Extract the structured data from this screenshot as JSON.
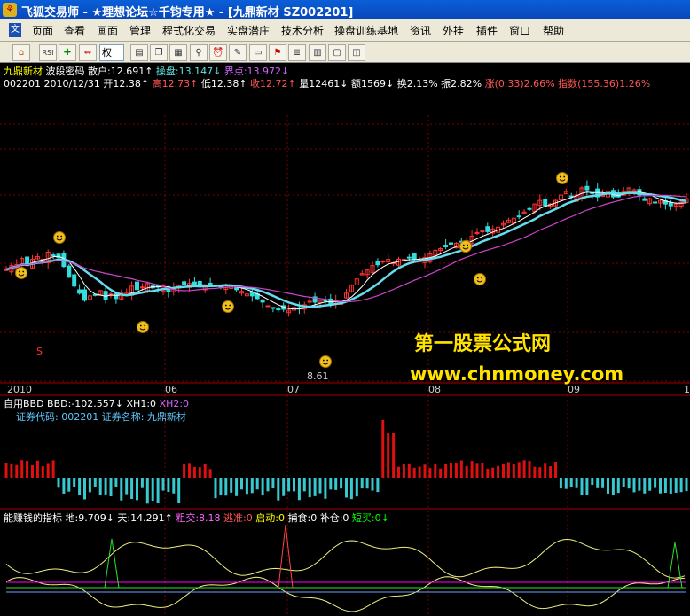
{
  "window": {
    "title": "飞狐交易师  - ★理想论坛☆千钧专用★ - [九鼎新材  SZ002201]",
    "logo_glyph": "⚘"
  },
  "menu": {
    "logo": "文",
    "items": [
      "页面",
      "查看",
      "画面",
      "管理",
      "程式化交易",
      "实盘潜庄",
      "技术分析",
      "操盘训练基地",
      "资讯",
      "外挂",
      "插件",
      "窗口",
      "帮助"
    ]
  },
  "toolbar": {
    "select_value": "权",
    "buttons": [
      "home-icon",
      "rsi-icon",
      "plus-cross-icon",
      "arrow-lr-icon",
      "select",
      "layout-icon",
      "copy-icon",
      "grid-icon",
      "zoom-icon",
      "alarm-icon",
      "pen-icon",
      "book-icon",
      "draw-icon",
      "list-icon",
      "panel-icon",
      "window-icon",
      "chart-icon"
    ]
  },
  "header": {
    "line1": [
      {
        "text": "九鼎新材",
        "color": "#ffff00"
      },
      {
        "text": " 波段密码",
        "color": "#ffffff"
      },
      {
        "text": " 散户:12.691↑",
        "color": "#ffffff"
      },
      {
        "text": " 操盘:13.147↓",
        "color": "#5fe0e0"
      },
      {
        "text": " 界点:13.972↓",
        "color": "#d066ff"
      }
    ],
    "line2": [
      {
        "text": "002201 2010/12/31",
        "color": "#ffffff"
      },
      {
        "text": " 开12.38↑",
        "color": "#ffffff"
      },
      {
        "text": " 高12.73↑",
        "color": "#ff5555"
      },
      {
        "text": " 低12.38↑",
        "color": "#ffffff"
      },
      {
        "text": " 收12.72↑",
        "color": "#ff5555"
      },
      {
        "text": " 量12461↓",
        "color": "#ffffff"
      },
      {
        "text": " 额1569↓",
        "color": "#ffffff"
      },
      {
        "text": " 换2.13%",
        "color": "#ffffff"
      },
      {
        "text": " 振2.82%",
        "color": "#ffffff"
      },
      {
        "text": " 涨(0.33)2.66%",
        "color": "#ff5555"
      },
      {
        "text": " 指数(155.36)1.26%",
        "color": "#ff5555"
      }
    ]
  },
  "price_panel": {
    "low_label": "8.61",
    "s_marker": "S",
    "date_labels": [
      "2010",
      "06",
      "07",
      "08",
      "09",
      "1"
    ]
  },
  "watermark": {
    "line1": "第一股票公式网",
    "line2": "www.chnmoney.com"
  },
  "bbd_panel": {
    "line1": [
      {
        "text": "自用BBD BBD:-102.557↓",
        "color": "#ffffff"
      },
      {
        "text": " XH1:0",
        "color": "#ffffff"
      },
      {
        "text": " XH2:0",
        "color": "#d066ff"
      }
    ],
    "line2": "证券代码: 002201 证券名称: 九鼎新材"
  },
  "indicator_panel": {
    "line": [
      {
        "text": "能赚钱的指标 地:9.709↓",
        "color": "#ffffff"
      },
      {
        "text": "天:14.291↑",
        "color": "#ffffff"
      },
      {
        "text": "粗交:8.18",
        "color": "#ff66ff"
      },
      {
        "text": "逃准:0",
        "color": "#ff5555"
      },
      {
        "text": "启动:0",
        "color": "#ffff00"
      },
      {
        "text": "捕食:0",
        "color": "#ffffff"
      },
      {
        "text": "补仓:0",
        "color": "#ffffff"
      },
      {
        "text": "短买:0↓",
        "color": "#00ff00"
      }
    ]
  },
  "colors": {
    "up": "#ff3333",
    "down": "#33dddd",
    "line_white": "#ffffff",
    "line_cyan": "#66ddee",
    "line_magenta": "#cc44cc",
    "bbd_up": "#e01010",
    "bbd_down": "#38c8d0",
    "ind_yellow": "#f0f080",
    "ind_green": "#30e030",
    "ind_magenta": "#ff00ff",
    "ind_blue": "#6aa0ff",
    "grid": "#7a0000",
    "smile": "#f0c020"
  },
  "price_series": [
    12.72,
    12.95,
    13.0,
    13.35,
    12.95,
    13.3,
    13.45,
    13.3,
    13.7,
    13.5,
    13.4,
    12.9,
    12.3,
    11.8,
    11.4,
    11.0,
    11.25,
    11.3,
    11.55,
    11.05,
    11.35,
    11.1,
    11.45,
    11.4,
    11.8,
    11.6,
    11.75,
    11.95,
    11.7,
    11.75,
    11.8,
    11.5,
    11.7,
    11.85,
    11.9,
    11.95,
    11.9,
    11.8,
    11.8,
    11.85,
    11.85,
    11.75,
    11.85,
    11.75,
    11.6,
    11.5,
    11.35,
    11.25,
    11.1,
    10.9,
    10.7,
    10.55,
    10.5,
    10.5,
    10.45,
    10.6,
    10.55,
    10.75,
    10.95,
    10.9,
    11.0,
    10.95,
    10.8,
    11.0,
    10.9,
    11.4,
    11.85,
    12.2,
    12.5,
    12.7,
    12.95,
    13.0,
    13.2,
    13.3,
    13.1,
    13.3,
    13.3,
    13.4,
    13.3,
    13.3,
    13.4,
    13.6,
    13.8,
    13.9,
    14.0,
    14.15,
    14.2,
    14.3,
    14.35,
    14.6,
    14.8,
    14.9,
    14.85,
    15.0,
    15.1,
    15.3,
    15.5,
    15.6,
    15.7,
    15.95,
    16.1,
    16.4,
    16.6,
    16.3,
    16.4,
    16.6,
    16.9,
    17.1,
    16.8,
    16.9,
    17.3,
    17.2,
    17.0,
    16.8,
    16.9,
    17.1,
    16.8,
    16.8,
    17.1,
    17.3,
    17.2,
    16.9,
    16.6,
    16.7,
    16.5,
    16.6,
    16.4,
    16.3,
    16.4,
    16.5,
    16.7
  ]
}
